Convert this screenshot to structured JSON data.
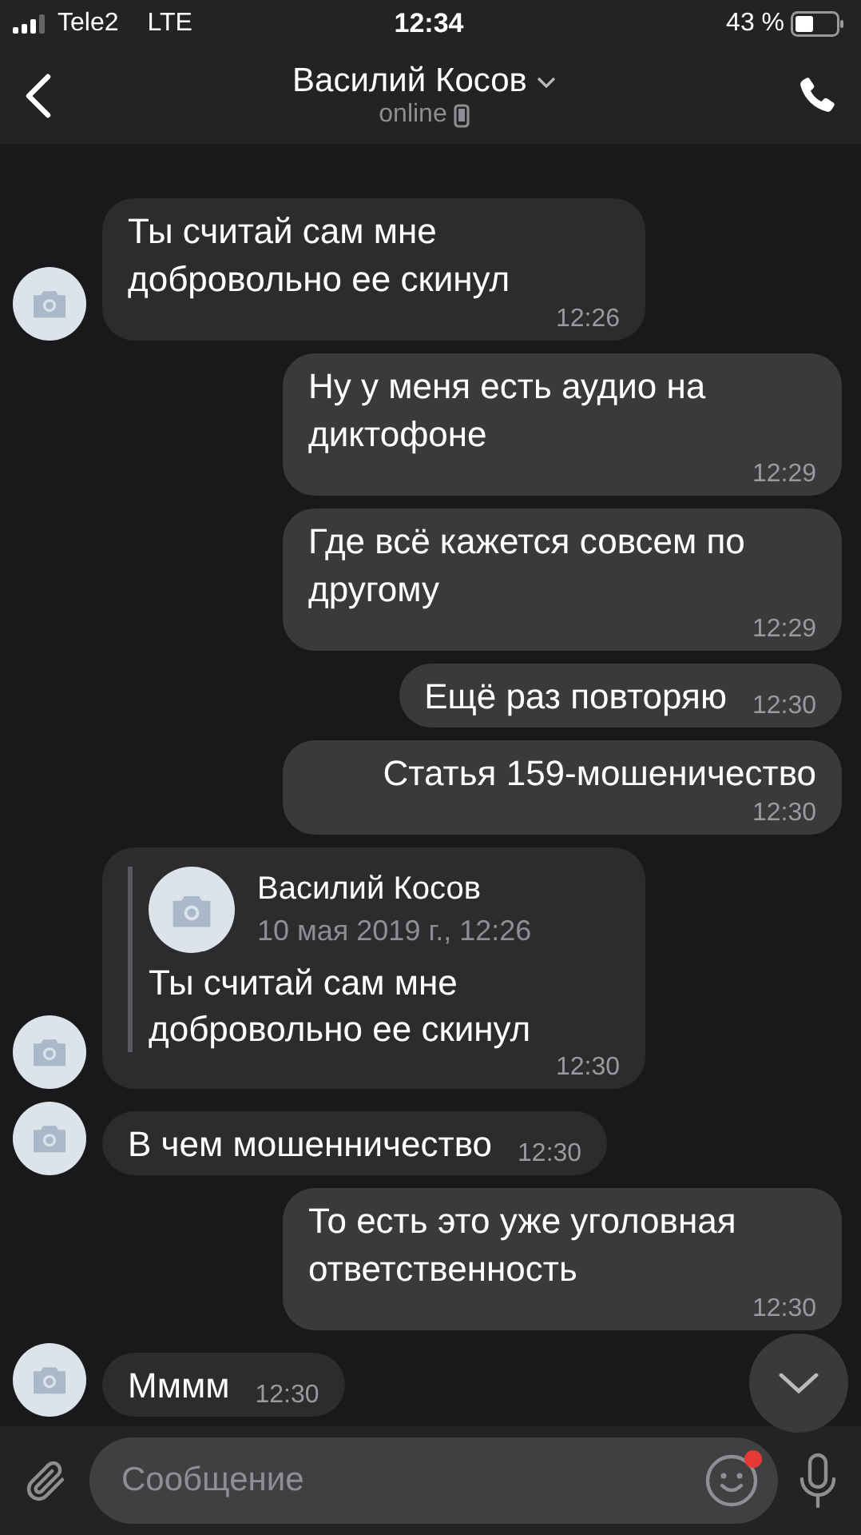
{
  "status_bar": {
    "carrier": "Tele2",
    "network": "LTE",
    "time": "12:34",
    "battery": "43 %"
  },
  "header": {
    "title": "Василий Косов",
    "status": "online"
  },
  "messages": [
    {
      "kind": "text",
      "incoming": true,
      "text": "Ты считай сам мне добровольно ее скинул",
      "time": "12:26"
    },
    {
      "kind": "text",
      "incoming": false,
      "text": "Ну у меня есть аудио на диктофоне",
      "time": "12:29"
    },
    {
      "kind": "text",
      "incoming": false,
      "text": "Где всё кажется совсем по другому",
      "time": "12:29"
    },
    {
      "kind": "text",
      "incoming": false,
      "text": "Ещё раз повторяю",
      "time": "12:30"
    },
    {
      "kind": "text",
      "incoming": false,
      "text": "Статья 159-мошеничество",
      "time": "12:30"
    },
    {
      "kind": "reply",
      "incoming": true,
      "quote": {
        "author": "Василий Косов",
        "date": "10 мая 2019 г., 12:26",
        "text": "Ты считай сам мне добровольно ее скинул"
      },
      "time": "12:30"
    },
    {
      "kind": "text",
      "incoming": true,
      "text": "В чем мошенничество",
      "time": "12:30"
    },
    {
      "kind": "text",
      "incoming": false,
      "text": "То есть это уже уголовная ответственность",
      "time": "12:30"
    },
    {
      "kind": "text",
      "incoming": true,
      "text": "Мммм",
      "time": "12:30"
    }
  ],
  "composer": {
    "placeholder": "Сообщение",
    "emoji_badge": true
  }
}
